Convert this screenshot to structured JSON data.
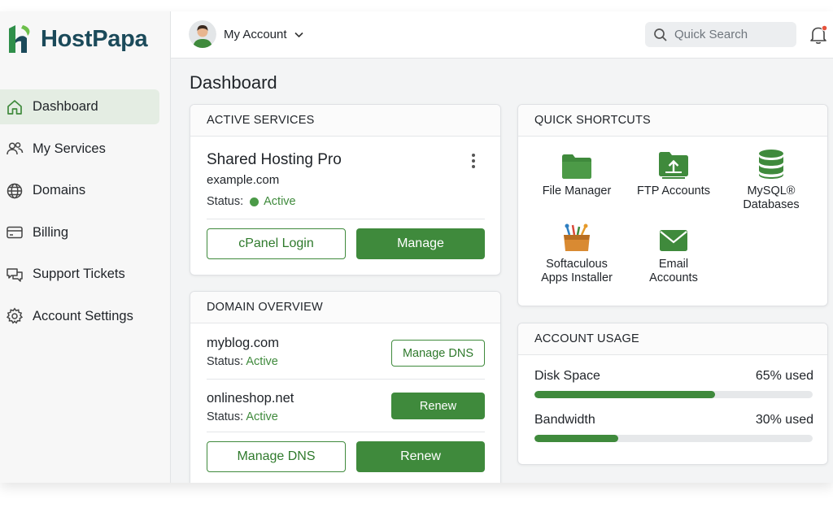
{
  "brand": {
    "name": "HostPapa"
  },
  "sidebar": {
    "items": [
      {
        "label": "Dashboard",
        "icon": "home-icon",
        "active": true
      },
      {
        "label": "My Services",
        "icon": "users-icon"
      },
      {
        "label": "Domains",
        "icon": "globe-icon"
      },
      {
        "label": "Billing",
        "icon": "credit-card-icon"
      },
      {
        "label": "Support Tickets",
        "icon": "chat-bubbles-icon"
      },
      {
        "label": "Account Settings",
        "icon": "gear-icon"
      }
    ]
  },
  "header": {
    "account_label": "My Account",
    "search_placeholder": "Quick Search",
    "notification_dot_color": "#e5533d"
  },
  "page": {
    "title": "Dashboard"
  },
  "active_services": {
    "heading": "ACTIVE SERVICES",
    "service_name": "Shared Hosting Pro",
    "domain": "example.com",
    "status_label": "Status:",
    "status_value": "Active",
    "cpanel_button": "cPanel Login",
    "manage_button": "Manage"
  },
  "domain_overview": {
    "heading": "DOMAIN OVERVIEW",
    "domains": [
      {
        "name": "myblog.com",
        "status_label": "Status:",
        "status_value": "Active",
        "action": "Manage DNS"
      },
      {
        "name": "onlineshop.net",
        "status_label": "Status:",
        "status_value": "Active",
        "action": "Renew"
      }
    ],
    "footer_buttons": {
      "manage_dns": "Manage DNS",
      "renew": "Renew"
    }
  },
  "quick_shortcuts": {
    "heading": "QUICK SHORTCUTS",
    "items": [
      {
        "label": "File Manager",
        "icon": "folder-icon"
      },
      {
        "label": "FTP Accounts",
        "icon": "folder-upload-icon"
      },
      {
        "label": "MySQL®\nDatabases",
        "icon": "database-icon"
      },
      {
        "label": "Softaculous\nApps Installer",
        "icon": "softaculous-box-icon"
      },
      {
        "label": "Email\nAccounts",
        "icon": "envelope-icon"
      }
    ]
  },
  "account_usage": {
    "heading": "ACCOUNT USAGE",
    "metrics": [
      {
        "label": "Disk Space",
        "value_text": "65% used",
        "percent": 65
      },
      {
        "label": "Bandwidth",
        "value_text": "30% used",
        "percent": 30
      }
    ]
  },
  "colors": {
    "accent": "#3f8a3c",
    "brand_text": "#1b4a5a",
    "active_nav_bg": "#e4ede3"
  }
}
